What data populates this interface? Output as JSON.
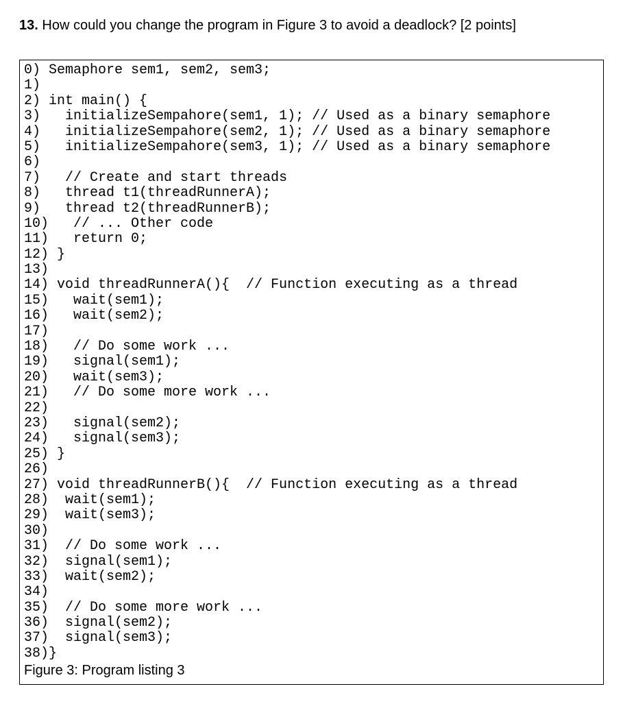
{
  "question": {
    "number": "13.",
    "text": "How could you change the program in Figure 3 to avoid a deadlock? [2 points]"
  },
  "code_lines": [
    "0) Semaphore sem1, sem2, sem3;",
    "1)",
    "2) int main() {",
    "3)   initializeSempahore(sem1, 1); // Used as a binary semaphore",
    "4)   initializeSempahore(sem2, 1); // Used as a binary semaphore",
    "5)   initializeSempahore(sem3, 1); // Used as a binary semaphore",
    "6)",
    "7)   // Create and start threads",
    "8)   thread t1(threadRunnerA);",
    "9)   thread t2(threadRunnerB);",
    "10)   // ... Other code",
    "11)   return 0;",
    "12) }",
    "13)",
    "14) void threadRunnerA(){  // Function executing as a thread",
    "15)   wait(sem1);",
    "16)   wait(sem2);",
    "17)",
    "18)   // Do some work ...",
    "19)   signal(sem1);",
    "20)   wait(sem3);",
    "21)   // Do some more work ...",
    "22)",
    "23)   signal(sem2);",
    "24)   signal(sem3);",
    "25) }",
    "26)",
    "27) void threadRunnerB(){  // Function executing as a thread",
    "28)  wait(sem1);",
    "29)  wait(sem3);",
    "30)",
    "31)  // Do some work ...",
    "32)  signal(sem1);",
    "33)  wait(sem2);",
    "34)",
    "35)  // Do some more work ...",
    "36)  signal(sem2);",
    "37)  signal(sem3);",
    "38)}"
  ],
  "caption": "Figure 3: Program listing 3"
}
